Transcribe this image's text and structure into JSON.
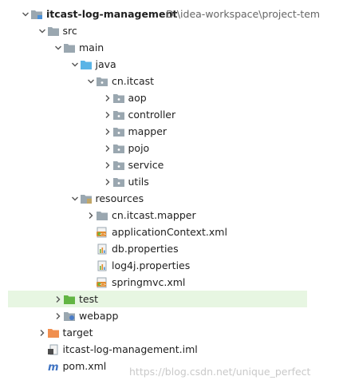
{
  "project": {
    "name": "itcast-log-management",
    "path": "D:\\idea-workspace\\project-tem"
  },
  "tree": [
    {
      "label": "itcast-log-management",
      "level": 0,
      "expanded": true,
      "icon": "module-folder-icon"
    },
    {
      "label": "src",
      "level": 1,
      "expanded": true,
      "icon": "folder-icon"
    },
    {
      "label": "main",
      "level": 2,
      "expanded": true,
      "icon": "folder-icon"
    },
    {
      "label": "java",
      "level": 3,
      "expanded": true,
      "icon": "source-root-folder-icon"
    },
    {
      "label": "cn.itcast",
      "level": 4,
      "expanded": true,
      "icon": "package-icon"
    },
    {
      "label": "aop",
      "level": 5,
      "expanded": false,
      "icon": "package-icon"
    },
    {
      "label": "controller",
      "level": 5,
      "expanded": false,
      "icon": "package-icon"
    },
    {
      "label": "mapper",
      "level": 5,
      "expanded": false,
      "icon": "package-icon"
    },
    {
      "label": "pojo",
      "level": 5,
      "expanded": false,
      "icon": "package-icon"
    },
    {
      "label": "service",
      "level": 5,
      "expanded": false,
      "icon": "package-icon"
    },
    {
      "label": "utils",
      "level": 5,
      "expanded": false,
      "icon": "package-icon"
    },
    {
      "label": "resources",
      "level": 3,
      "expanded": true,
      "icon": "resources-folder-icon"
    },
    {
      "label": "cn.itcast.mapper",
      "level": 4,
      "expanded": false,
      "icon": "folder-icon"
    },
    {
      "label": "applicationContext.xml",
      "level": 4,
      "icon": "spring-xml-icon"
    },
    {
      "label": "db.properties",
      "level": 4,
      "icon": "properties-file-icon"
    },
    {
      "label": "log4j.properties",
      "level": 4,
      "icon": "properties-file-icon"
    },
    {
      "label": "springmvc.xml",
      "level": 4,
      "icon": "spring-xml-icon"
    },
    {
      "label": "test",
      "level": 2,
      "expanded": false,
      "icon": "test-folder-icon"
    },
    {
      "label": "webapp",
      "level": 2,
      "expanded": false,
      "icon": "web-folder-icon"
    },
    {
      "label": "target",
      "level": 1,
      "expanded": false,
      "icon": "excluded-folder-icon"
    },
    {
      "label": "itcast-log-management.iml",
      "level": 1,
      "icon": "iml-file-icon"
    },
    {
      "label": "pom.xml",
      "level": 1,
      "icon": "maven-icon"
    }
  ],
  "selected_label": "test",
  "watermark": "https://blog.csdn.net/unique_perfect",
  "colors": {
    "folder": "#9aa7b0",
    "source_root": "#5ab4e6",
    "test_folder": "#62b543",
    "excluded": "#f08f4f",
    "selection": "#e7f6e2"
  }
}
